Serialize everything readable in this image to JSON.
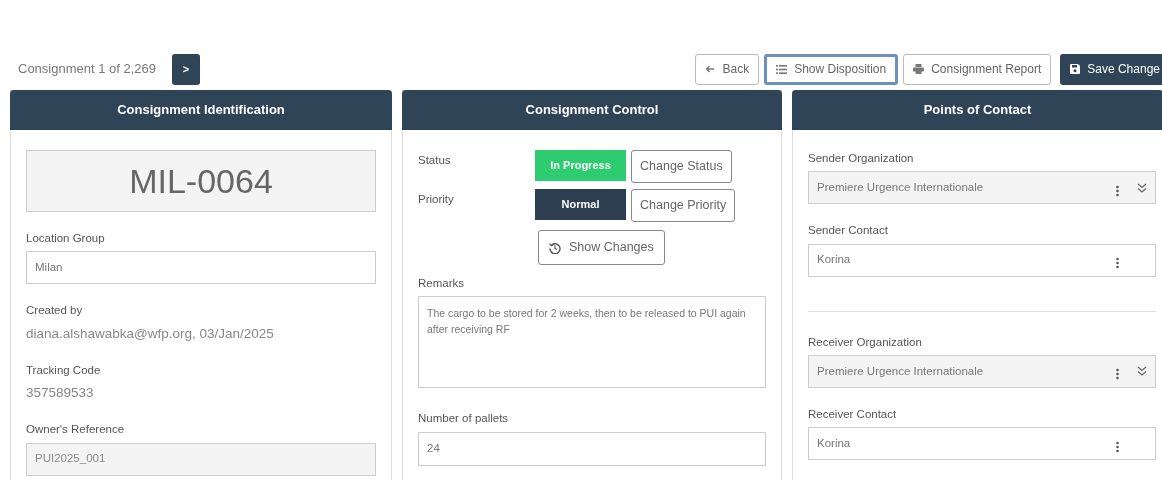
{
  "navigator": {
    "text": "Consignment 1 of 2,269",
    "next": ">"
  },
  "toolbar": [
    {
      "label": "Back",
      "kind": "outline",
      "focused": false
    },
    {
      "label": "Show Disposition",
      "kind": "outline",
      "focused": true
    },
    {
      "label": "Consignment Report",
      "kind": "outline",
      "focused": false
    },
    {
      "label": "Save Change",
      "kind": "primary",
      "focused": false
    }
  ],
  "identification": {
    "title": "Consignment Identification",
    "code": "MIL-0064",
    "fields": [
      {
        "kind": "input",
        "label": "Location Group",
        "value": "Milan"
      },
      {
        "kind": "text",
        "label": "Created by",
        "value": "diana.alshawabka@wfp.org, 03/Jan/2025"
      },
      {
        "kind": "text",
        "label": "Tracking Code",
        "value": "357589533"
      },
      {
        "kind": "readonly",
        "label": "Owner's Reference",
        "value": "PUI2025_001"
      }
    ]
  },
  "control": {
    "title": "Consignment Control",
    "rows": [
      {
        "label": "Status",
        "badge": "In Progress",
        "color": "#2ecc71",
        "action": "Change Status"
      },
      {
        "label": "Priority",
        "badge": "Normal",
        "color": "#2c3e50",
        "action": "Change Priority"
      }
    ],
    "show_changes": "Show Changes",
    "remarks": {
      "label": "Remarks",
      "value": "The cargo to be stored for 2 weeks, then to be released to PUI again after receiving RF"
    },
    "pallets": {
      "label": "Number of pallets",
      "value": "24"
    }
  },
  "contacts": {
    "title": "Points of Contact",
    "groups": [
      [
        {
          "kind": "select",
          "label": "Sender Organization",
          "value": "Premiere Urgence Internationale"
        },
        {
          "kind": "contact",
          "label": "Sender Contact",
          "value": "Korina"
        }
      ],
      [
        {
          "kind": "select",
          "label": "Receiver Organization",
          "value": "Premiere Urgence Internationale"
        },
        {
          "kind": "contact",
          "label": "Receiver Contact",
          "value": "Korina"
        }
      ]
    ]
  }
}
